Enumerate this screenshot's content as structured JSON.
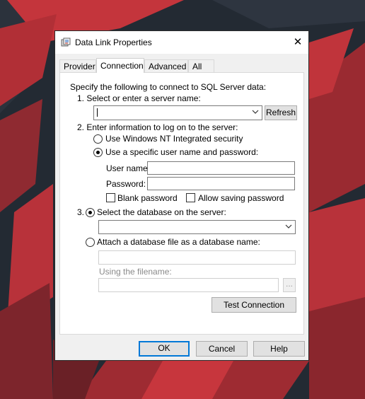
{
  "dialog": {
    "title": "Data Link Properties",
    "close_glyph": "✕"
  },
  "tabs": [
    {
      "label": "Provider",
      "active": false
    },
    {
      "label": "Connection",
      "active": true
    },
    {
      "label": "Advanced",
      "active": false
    },
    {
      "label": "All",
      "active": false
    }
  ],
  "connection": {
    "intro": "Specify the following to connect to SQL Server data:",
    "step1_label": "1. Select or enter a server name:",
    "server_name_value": "",
    "refresh_label": "Refresh",
    "step2_label": "2. Enter information to log on to the server:",
    "nt_security_label": "Use Windows NT Integrated security",
    "specific_user_label": "Use a specific user name and password:",
    "selected_auth": "specific_user",
    "user_name_label": "User name:",
    "user_name_value": "",
    "password_label": "Password:",
    "password_value": "",
    "blank_password_label": "Blank password",
    "blank_password_checked": false,
    "allow_saving_label": "Allow saving password",
    "allow_saving_checked": false,
    "step3_number": "3.",
    "select_db_label": "Select the database on the server:",
    "database_value": "",
    "attach_db_label": "Attach a database file as a database name:",
    "selected_db_mode": "select",
    "using_filename_label": "Using the filename:",
    "browse_label": "...",
    "test_connection_label": "Test Connection"
  },
  "footer": {
    "ok_label": "OK",
    "cancel_label": "Cancel",
    "help_label": "Help"
  },
  "icons": {
    "title_icon": "data-link-icon",
    "dropdown": "chevron-down-icon"
  }
}
